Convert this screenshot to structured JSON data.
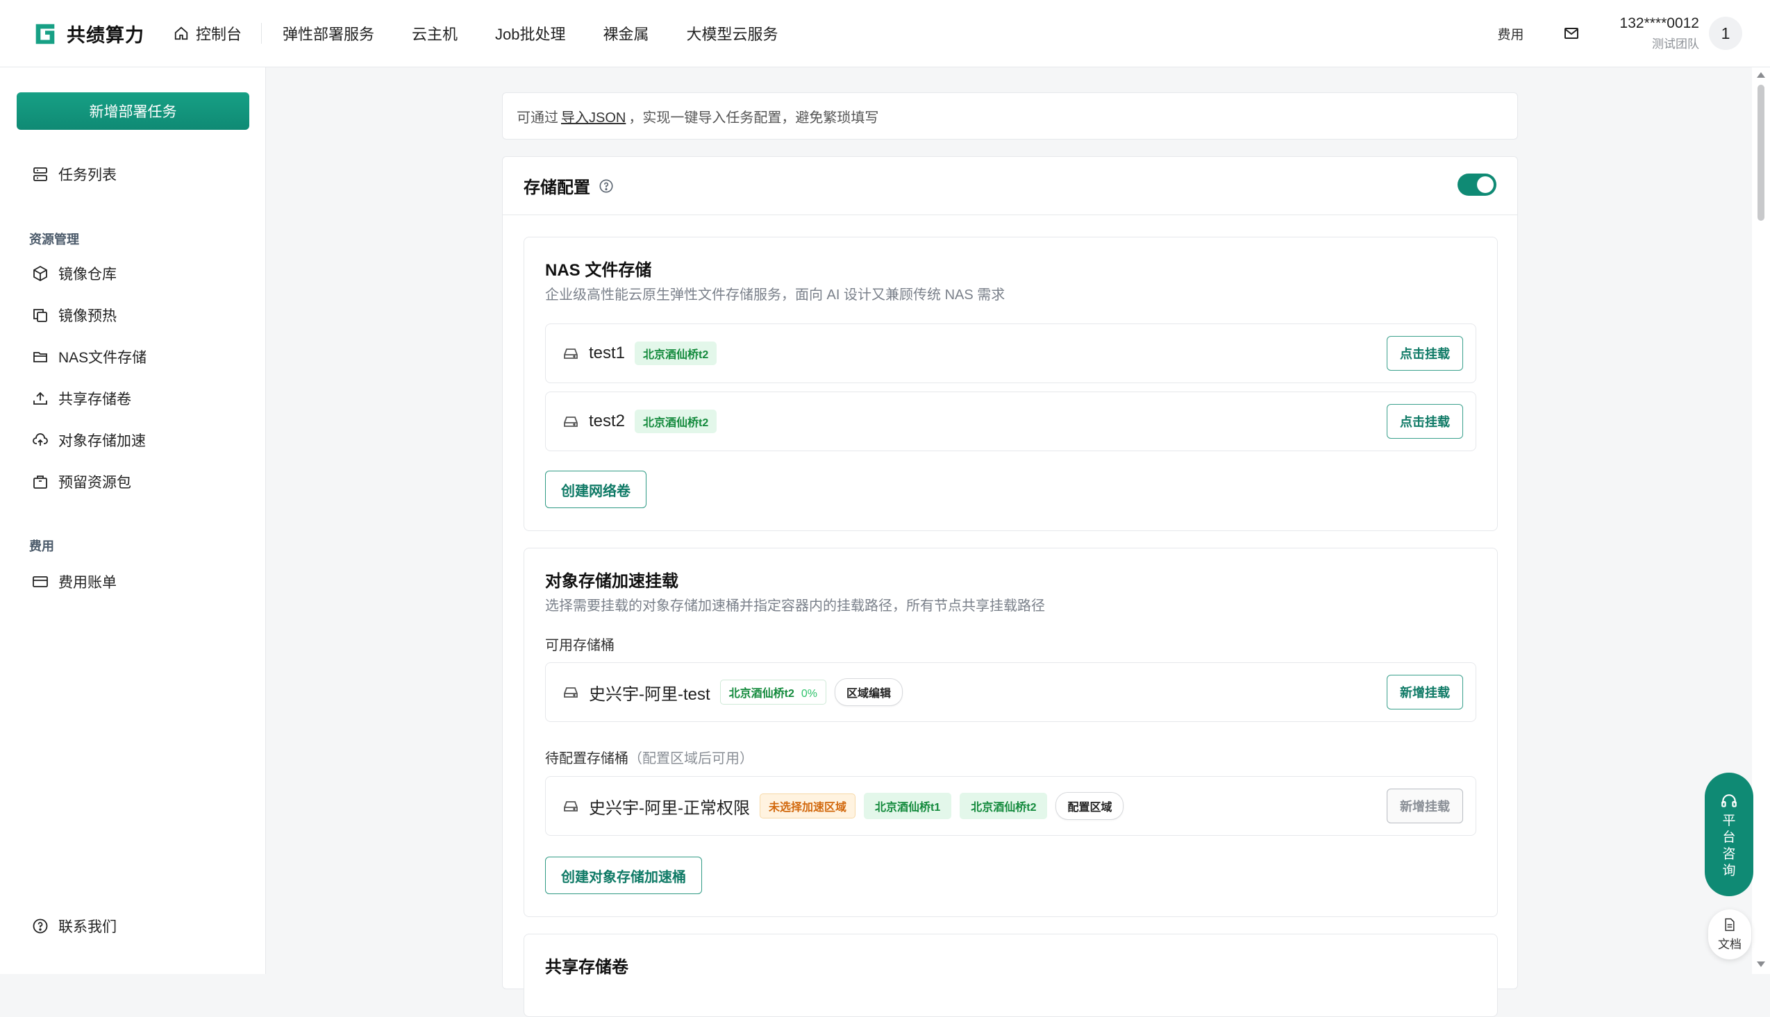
{
  "brand": {
    "name": "共绩算力",
    "color": "#0f8a74"
  },
  "nav": {
    "home": "控制台",
    "items": [
      "弹性部署服务",
      "云主机",
      "Job批处理",
      "裸金属",
      "大模型云服务"
    ]
  },
  "header": {
    "fee": "费用",
    "phone": "132****0012",
    "team": "测试团队",
    "avatar": "1"
  },
  "sidebar": {
    "new_task": "新增部署任务",
    "task_list": "任务列表",
    "group_resource": "资源管理",
    "resource_items": [
      "镜像仓库",
      "镜像预热",
      "NAS文件存储",
      "共享存储卷",
      "对象存储加速",
      "预留资源包"
    ],
    "group_fee": "费用",
    "fee_items": [
      "费用账单"
    ],
    "contact": "联系我们"
  },
  "import_bar": {
    "prefix": "可通过",
    "link": "导入JSON",
    "suffix": "，实现一键导入任务配置，避免繁琐填写"
  },
  "storage": {
    "title": "存储配置",
    "enabled": true,
    "nas": {
      "title": "NAS 文件存储",
      "desc": "企业级高性能云原生弹性文件存储服务，面向 AI 设计又兼顾传统 NAS 需求",
      "rows": [
        {
          "name": "test1",
          "region": "北京酒仙桥t2",
          "action": "点击挂载"
        },
        {
          "name": "test2",
          "region": "北京酒仙桥t2",
          "action": "点击挂载"
        }
      ],
      "create": "创建网络卷"
    },
    "oss": {
      "title": "对象存储加速挂载",
      "desc": "选择需要挂载的对象存储加速桶并指定容器内的挂载路径，所有节点共享挂载路径",
      "available_label": "可用存储桶",
      "available": {
        "name": "史兴宇-阿里-test",
        "region": "北京酒仙桥t2",
        "percent": "0%",
        "edit": "区域编辑",
        "action": "新增挂载"
      },
      "pending_label": "待配置存储桶",
      "pending_hint": "（配置区域后可用）",
      "pending": {
        "name": "史兴宇-阿里-正常权限",
        "warn": "未选择加速区域",
        "regions": [
          "北京酒仙桥t1",
          "北京酒仙桥t2"
        ],
        "config": "配置区域",
        "action": "新增挂载"
      },
      "create": "创建对象存储加速桶"
    },
    "shared": {
      "title": "共享存储卷"
    }
  },
  "float": {
    "consult": [
      "平",
      "台",
      "咨",
      "询"
    ],
    "docs": "文档"
  }
}
